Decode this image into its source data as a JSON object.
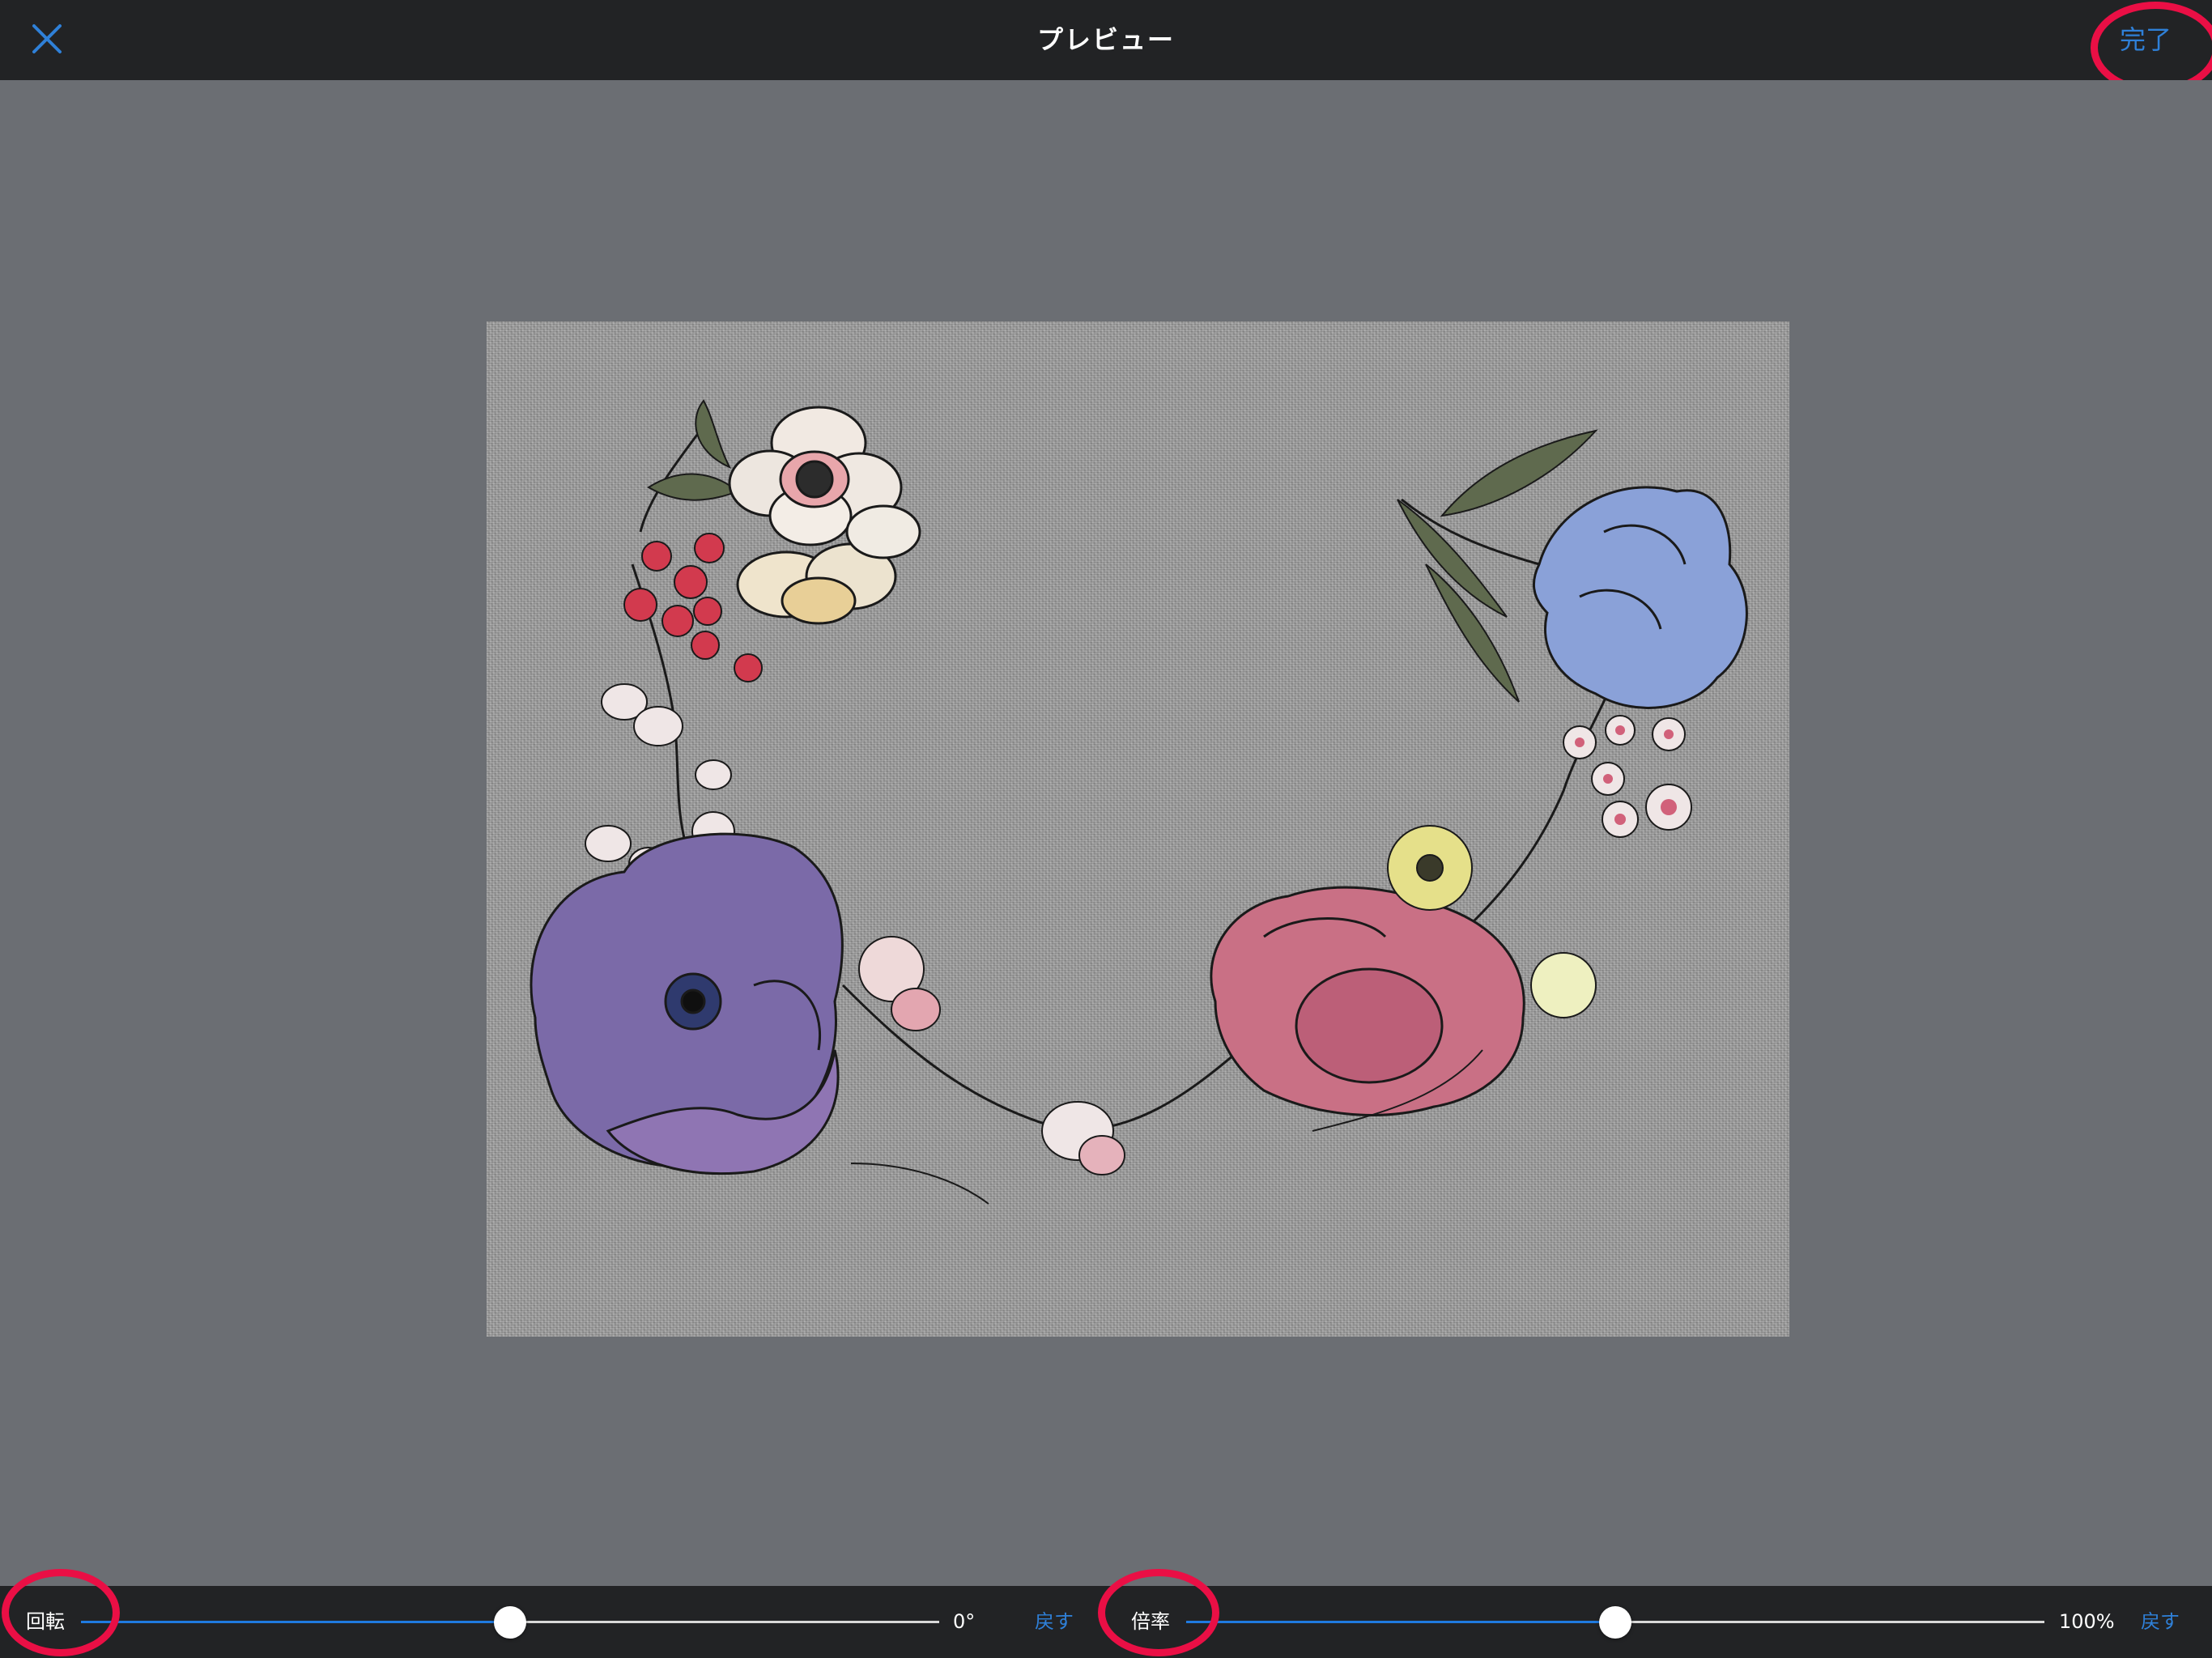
{
  "header": {
    "title": "プレビュー",
    "done_label": "完了",
    "close_icon": "close-icon"
  },
  "preview": {
    "image_description_icon": "floral-wreath-image"
  },
  "controls": {
    "rotation": {
      "label": "回転",
      "value_text": "0°",
      "reset_label": "戻す",
      "level_fraction": 0.5
    },
    "scale": {
      "label": "倍率",
      "value_text": "100%",
      "reset_label": "戻す",
      "level_fraction": 0.5
    }
  },
  "colors": {
    "bar_background": "#222325",
    "canvas_background": "#6b6e73",
    "accent": "#2f80d8",
    "highlight_ring": "#ea0f45"
  }
}
